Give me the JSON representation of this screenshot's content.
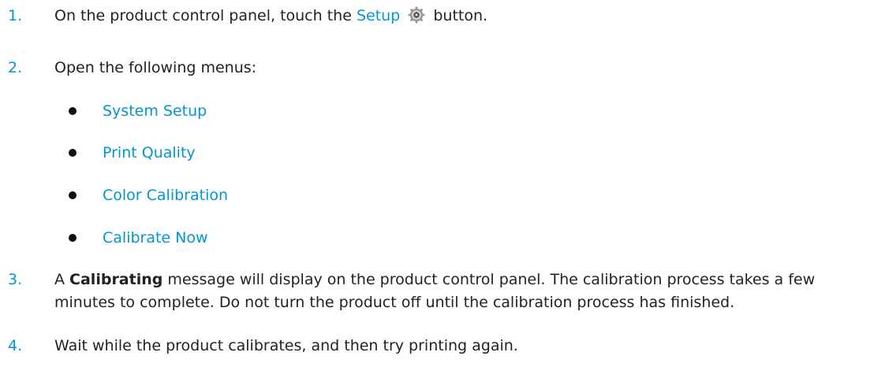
{
  "steps": [
    {
      "number": "1.",
      "before": "On the product control panel, touch the ",
      "link": "Setup",
      "icon": "gear-icon",
      "after": " button."
    },
    {
      "number": "2.",
      "text": "Open the following menus:",
      "menus": [
        "System Setup",
        "Print Quality",
        "Color Calibration",
        "Calibrate Now"
      ]
    },
    {
      "number": "3.",
      "before": "A ",
      "bold": "Calibrating",
      "line1_after": " message will display on the product control panel. The calibration process takes a few",
      "line2": "minutes to complete. Do not turn the product off until the calibration process has finished."
    },
    {
      "number": "4.",
      "text": "Wait while the product calibrates, and then try printing again."
    }
  ],
  "colors": {
    "accent": "#0096d6",
    "text": "#222222"
  }
}
